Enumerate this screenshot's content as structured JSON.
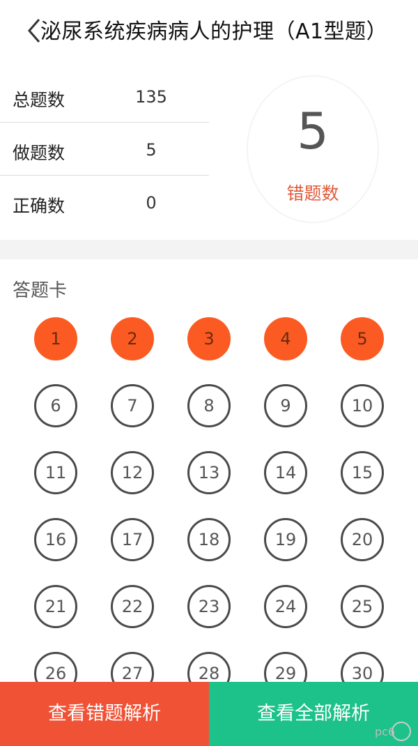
{
  "header": {
    "title": "泌尿系统疾病病人的护理（A1型题）"
  },
  "stats": {
    "total_label": "总题数",
    "total_value": "135",
    "done_label": "做题数",
    "done_value": "5",
    "correct_label": "正确数",
    "correct_value": "0"
  },
  "wrong": {
    "count": "5",
    "label": "错题数"
  },
  "answer_card": {
    "title": "答题卡",
    "wrong_color": "#fb5b22",
    "items": [
      {
        "n": "1",
        "state": "wrong"
      },
      {
        "n": "2",
        "state": "wrong"
      },
      {
        "n": "3",
        "state": "wrong"
      },
      {
        "n": "4",
        "state": "wrong"
      },
      {
        "n": "5",
        "state": "wrong"
      },
      {
        "n": "6",
        "state": "unanswered"
      },
      {
        "n": "7",
        "state": "unanswered"
      },
      {
        "n": "8",
        "state": "unanswered"
      },
      {
        "n": "9",
        "state": "unanswered"
      },
      {
        "n": "10",
        "state": "unanswered"
      },
      {
        "n": "11",
        "state": "unanswered"
      },
      {
        "n": "12",
        "state": "unanswered"
      },
      {
        "n": "13",
        "state": "unanswered"
      },
      {
        "n": "14",
        "state": "unanswered"
      },
      {
        "n": "15",
        "state": "unanswered"
      },
      {
        "n": "16",
        "state": "unanswered"
      },
      {
        "n": "17",
        "state": "unanswered"
      },
      {
        "n": "18",
        "state": "unanswered"
      },
      {
        "n": "19",
        "state": "unanswered"
      },
      {
        "n": "20",
        "state": "unanswered"
      },
      {
        "n": "21",
        "state": "unanswered"
      },
      {
        "n": "22",
        "state": "unanswered"
      },
      {
        "n": "23",
        "state": "unanswered"
      },
      {
        "n": "24",
        "state": "unanswered"
      },
      {
        "n": "25",
        "state": "unanswered"
      },
      {
        "n": "26",
        "state": "unanswered"
      },
      {
        "n": "27",
        "state": "unanswered"
      },
      {
        "n": "28",
        "state": "unanswered"
      },
      {
        "n": "29",
        "state": "unanswered"
      },
      {
        "n": "30",
        "state": "unanswered"
      }
    ]
  },
  "buttons": {
    "view_wrong": "查看错题解析",
    "view_wrong_color": "#f05236",
    "view_all": "查看全部解析",
    "view_all_color": "#1cc28a"
  },
  "watermark": {
    "text": "pc6"
  }
}
